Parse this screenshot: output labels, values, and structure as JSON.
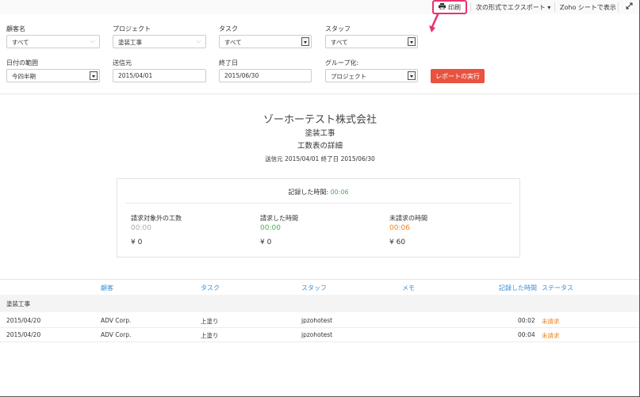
{
  "toolbar": {
    "print_label": "印刷",
    "export_label": "次の形式でエクスポート",
    "zoho_label": "Zoho シートで表示"
  },
  "filters": {
    "customer": {
      "label": "顧客名",
      "value": "すべて"
    },
    "project": {
      "label": "プロジェクト",
      "value": "塗装工事"
    },
    "task": {
      "label": "タスク",
      "value": "すべて"
    },
    "staff": {
      "label": "スタッフ",
      "value": "すべて"
    },
    "date_range": {
      "label": "日付の範囲",
      "value": "今四半期"
    },
    "from": {
      "label": "送信元",
      "value": "2015/04/01"
    },
    "to": {
      "label": "終了日",
      "value": "2015/06/30"
    },
    "group_by": {
      "label": "グループ化:",
      "value": "プロジェクト"
    },
    "run_label": "レポートの実行"
  },
  "report": {
    "company": "ゾーホーテスト株式会社",
    "project": "塗装工事",
    "subtitle": "工数表の詳細",
    "range": "送信元  2015/04/01  終了日  2015/06/30"
  },
  "summary": {
    "logged_label": "記録した時間:",
    "logged_value": "00:06",
    "cols": [
      {
        "label": "請求対象外の工数",
        "time": "00:00",
        "amount": "¥ 0",
        "color": "#aaaaaa"
      },
      {
        "label": "請求した時間",
        "time": "00:00",
        "amount": "¥ 0",
        "color": "#4caf50"
      },
      {
        "label": "未請求の時間",
        "time": "00:06",
        "amount": "¥ 60",
        "color": "#f0841a"
      }
    ]
  },
  "table": {
    "headers": {
      "customer": "顧客",
      "task": "タスク",
      "staff": "スタッフ",
      "memo": "メモ",
      "logged": "記録した時間",
      "status": "ステータス"
    },
    "group": "塗装工事",
    "rows": [
      {
        "date": "2015/04/20",
        "customer": "ADV Corp.",
        "task": "上塗り",
        "staff": "jpzohotest",
        "time": "00:02",
        "status": "未請求"
      },
      {
        "date": "2015/04/20",
        "customer": "ADV Corp.",
        "task": "上塗り",
        "staff": "jpzohotest",
        "time": "00:04",
        "status": "未請求"
      }
    ]
  },
  "colors": {
    "accent_pink": "#e8336d",
    "run_button": "#e8533f",
    "header_blue": "#3e8ed0",
    "unbilled_orange": "#f0841a"
  }
}
